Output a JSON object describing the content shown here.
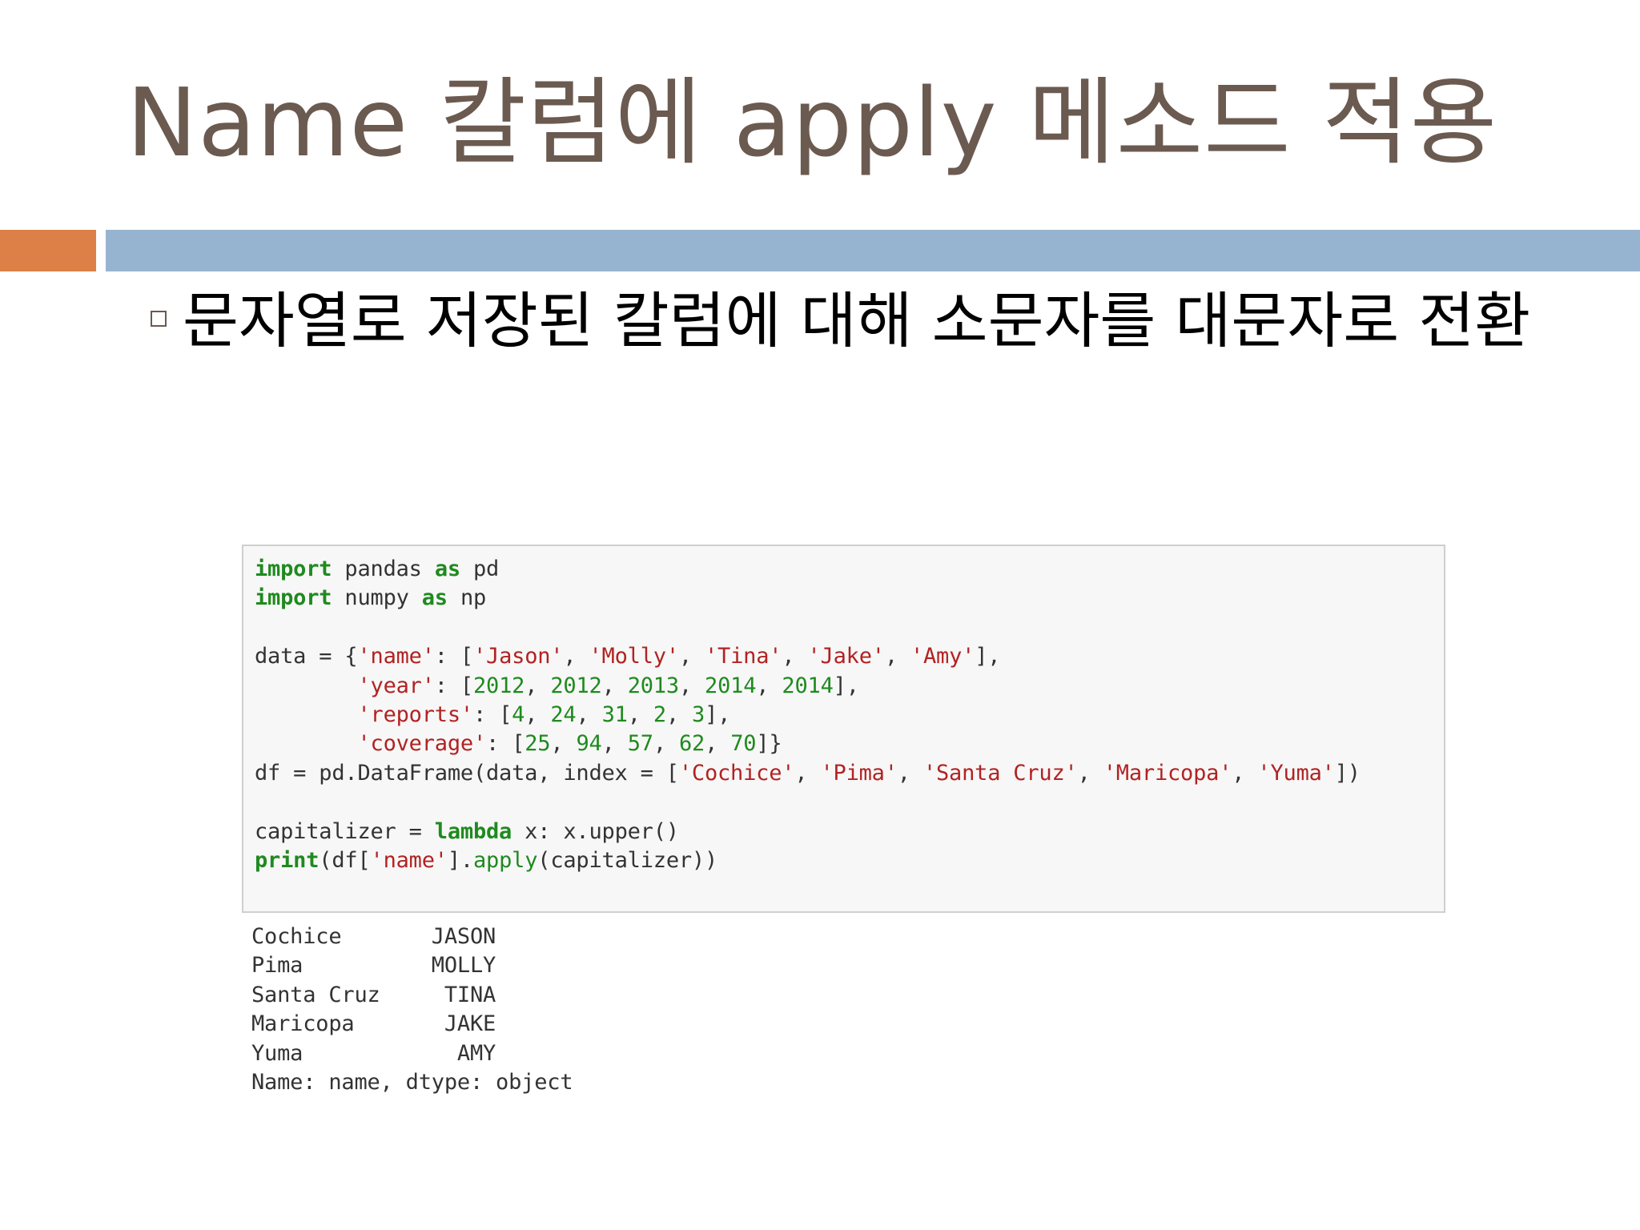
{
  "slide": {
    "title": "Name 칼럼에 apply 메소드 적용",
    "bullet": "문자열로 저장된 칼럼에 대해 소문자를 대문자로 전환"
  },
  "colors": {
    "title": "#6b5a50",
    "accent_orange": "#dc8047",
    "accent_blue": "#96b4d0",
    "code_keyword": "#1f8a1f",
    "code_string": "#b22222"
  },
  "code": {
    "import_kw": "import",
    "as_kw": "as",
    "pandas_mod": "pandas",
    "pd_alias": "pd",
    "numpy_mod": "numpy",
    "np_alias": "np",
    "data_assign": "data = {",
    "key_name": "'name'",
    "names": [
      "'Jason'",
      "'Molly'",
      "'Tina'",
      "'Jake'",
      "'Amy'"
    ],
    "key_year": "'year'",
    "years": [
      "2012",
      "2012",
      "2013",
      "2014",
      "2014"
    ],
    "key_reports": "'reports'",
    "reports": [
      "4",
      "24",
      "31",
      "2",
      "3"
    ],
    "key_coverage": "'coverage'",
    "coverage": [
      "25",
      "94",
      "57",
      "62",
      "70"
    ],
    "df_assign": "df = pd.DataFrame(data, index = [",
    "index": [
      "'Cochice'",
      "'Pima'",
      "'Santa Cruz'",
      "'Maricopa'",
      "'Yuma'"
    ],
    "cap_assign": "capitalizer = ",
    "lambda_kw": "lambda",
    "lambda_body": " x: x.upper()",
    "print_kw": "print",
    "print_open": "(df[",
    "print_close": "].",
    "apply_fn": "apply",
    "apply_args": "(capitalizer))"
  },
  "output": [
    "Cochice       JASON",
    "Pima          MOLLY",
    "Santa Cruz     TINA",
    "Maricopa       JAKE",
    "Yuma            AMY",
    "Name: name, dtype: object"
  ]
}
